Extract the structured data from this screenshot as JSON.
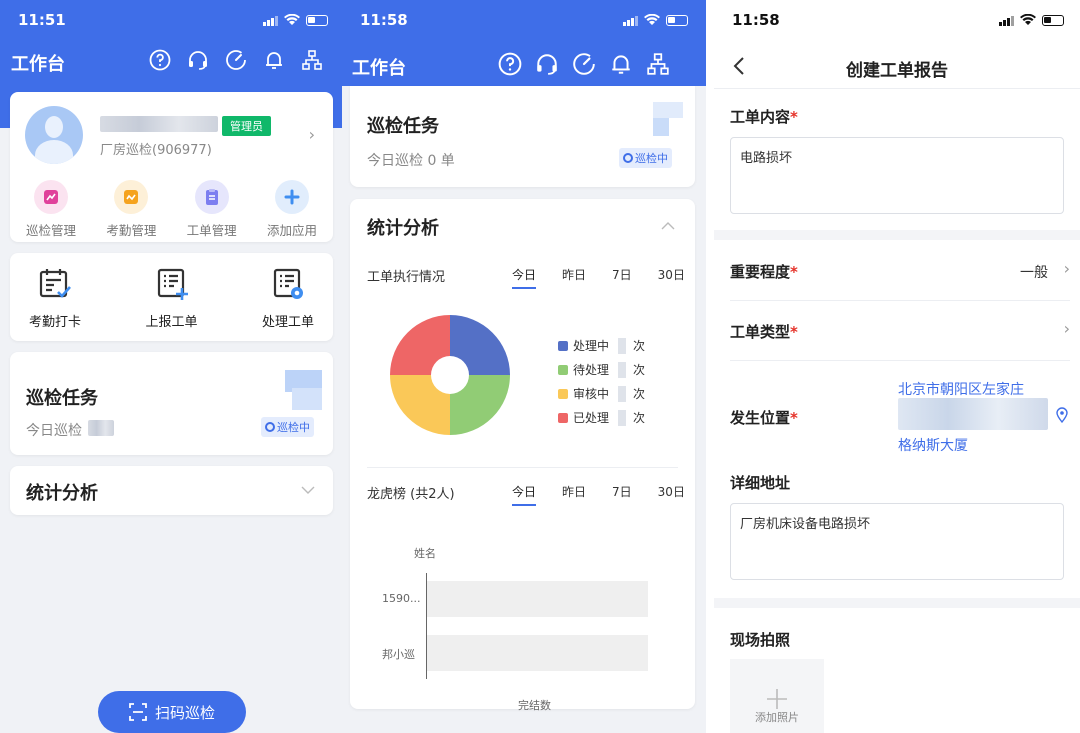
{
  "screen1": {
    "status_time": "11:51",
    "header_title": "工作台",
    "user": {
      "role_badge": "管理员",
      "subtitle": "厂房巡检(906977)"
    },
    "apps": [
      {
        "label": "巡检管理",
        "icon": "inspection-map-icon",
        "color": "#e0419b"
      },
      {
        "label": "考勤管理",
        "icon": "attendance-chart-icon",
        "color": "#f5a31e"
      },
      {
        "label": "工单管理",
        "icon": "clipboard-icon",
        "color": "#7c7ef0"
      },
      {
        "label": "添加应用",
        "icon": "plus-icon",
        "color": "#3f8ef0"
      }
    ],
    "quick_actions": [
      {
        "label": "考勤打卡",
        "icon": "calendar-check-icon"
      },
      {
        "label": "上报工单",
        "icon": "report-add-icon"
      },
      {
        "label": "处理工单",
        "icon": "report-process-icon"
      }
    ],
    "task": {
      "title": "巡检任务",
      "subtitle": "今日巡检",
      "badge": "巡检中"
    },
    "stats_title": "统计分析",
    "scan_button": "扫码巡检"
  },
  "screen2": {
    "status_time": "11:58",
    "header_title": "工作台",
    "task": {
      "title": "巡检任务",
      "subtitle": "今日巡检 0 单",
      "badge": "巡检中"
    },
    "stats_title": "统计分析",
    "work_order": {
      "title": "工单执行情况",
      "tabs": [
        "今日",
        "昨日",
        "7日",
        "30日"
      ],
      "active_tab": "今日",
      "legend": [
        {
          "label": "处理中",
          "unit": "次",
          "color": "#5470c6"
        },
        {
          "label": "待处理",
          "unit": "次",
          "color": "#91cc75"
        },
        {
          "label": "审核中",
          "unit": "次",
          "color": "#fac858"
        },
        {
          "label": "已处理",
          "unit": "次",
          "color": "#ee6666"
        }
      ]
    },
    "ranking": {
      "title": "龙虎榜 (共2人)",
      "tabs": [
        "今日",
        "昨日",
        "7日",
        "30日"
      ],
      "active_tab": "今日",
      "y_title": "姓名",
      "x_title": "完结数",
      "rows": [
        "1590...",
        "邦小巡"
      ]
    }
  },
  "chart_data": [
    {
      "type": "pie",
      "title": "工单执行情况",
      "categories": [
        "处理中",
        "待处理",
        "审核中",
        "已处理"
      ],
      "values": [
        1,
        1,
        1,
        1
      ]
    },
    {
      "type": "bar",
      "title": "龙虎榜 (共2人)",
      "categories": [
        "1590...",
        "邦小巡"
      ],
      "xlabel": "完结数",
      "ylabel": "姓名"
    }
  ],
  "screen3": {
    "status_time": "11:58",
    "title": "创建工单报告",
    "content_label": "工单内容",
    "content_value": "电路损坏",
    "importance_label": "重要程度",
    "importance_value": "一般",
    "type_label": "工单类型",
    "location_label": "发生位置",
    "location_line1": "北京市朝阳区左家庄",
    "location_line2": "格纳斯大厦",
    "address_label": "详细地址",
    "address_value": "厂房机床设备电路损坏",
    "photo_label": "现场拍照",
    "photo_add": "添加照片"
  }
}
